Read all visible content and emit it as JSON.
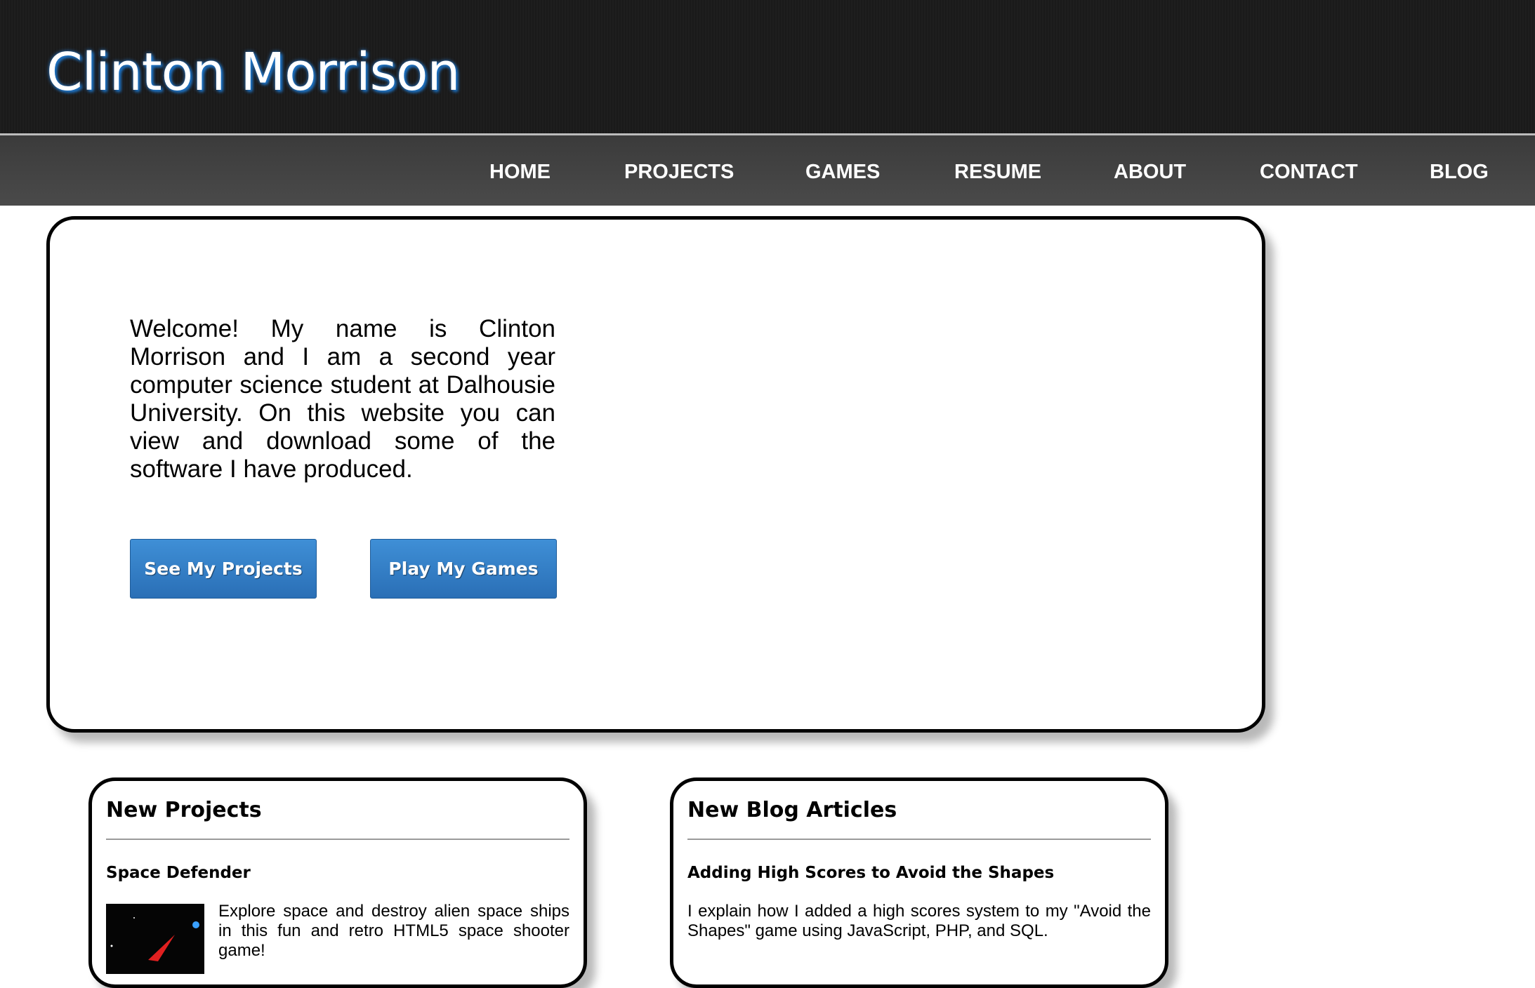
{
  "header": {
    "site_title": "Clinton Morrison"
  },
  "nav": {
    "items": [
      {
        "label": "HOME"
      },
      {
        "label": "PROJECTS"
      },
      {
        "label": "GAMES"
      },
      {
        "label": "RESUME"
      },
      {
        "label": "ABOUT"
      },
      {
        "label": "CONTACT"
      },
      {
        "label": "BLOG"
      }
    ]
  },
  "hero": {
    "welcome_text": "Welcome! My name is Clinton Morrison and I am a second year computer science student at Dalhousie University. On this website you can view and download some of the software I have produced.",
    "buttons": {
      "projects_label": "See My Projects",
      "games_label": "Play My Games"
    }
  },
  "new_projects": {
    "title": "New Projects",
    "item": {
      "title": "Space Defender",
      "description": "Explore space and destroy alien space ships in this fun and retro HTML5 space shooter game!",
      "thumbnail_icon": "space-game-thumbnail"
    }
  },
  "new_blog": {
    "title": "New Blog Articles",
    "item": {
      "title": "Adding High Scores to Avoid the Shapes",
      "description": "I explain how I added a high scores system to my \"Avoid the Shapes\" game using JavaScript, PHP, and SQL."
    }
  },
  "colors": {
    "header_bg": "#1c1c1c",
    "nav_bg": "#444444",
    "button_blue": "#2f7bc4",
    "title_glow": "#1c74c8"
  }
}
